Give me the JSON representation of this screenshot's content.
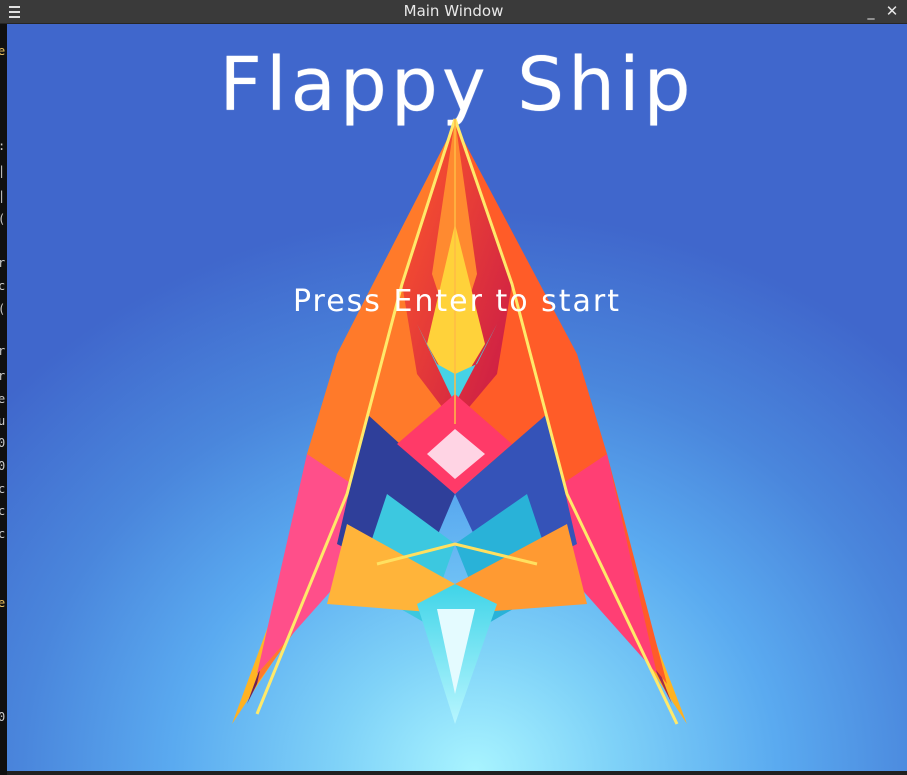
{
  "window": {
    "title": "Main Window",
    "menu_icon": "hamburger-menu-icon",
    "minimize_glyph": "_",
    "close_glyph": "✕"
  },
  "game": {
    "title": "Flappy Ship",
    "prompt": "Press Enter to start",
    "background_top": "#4067cc",
    "background_glow": "#a8f4ff",
    "ship_icon": "crystal-spaceship-graphic"
  }
}
